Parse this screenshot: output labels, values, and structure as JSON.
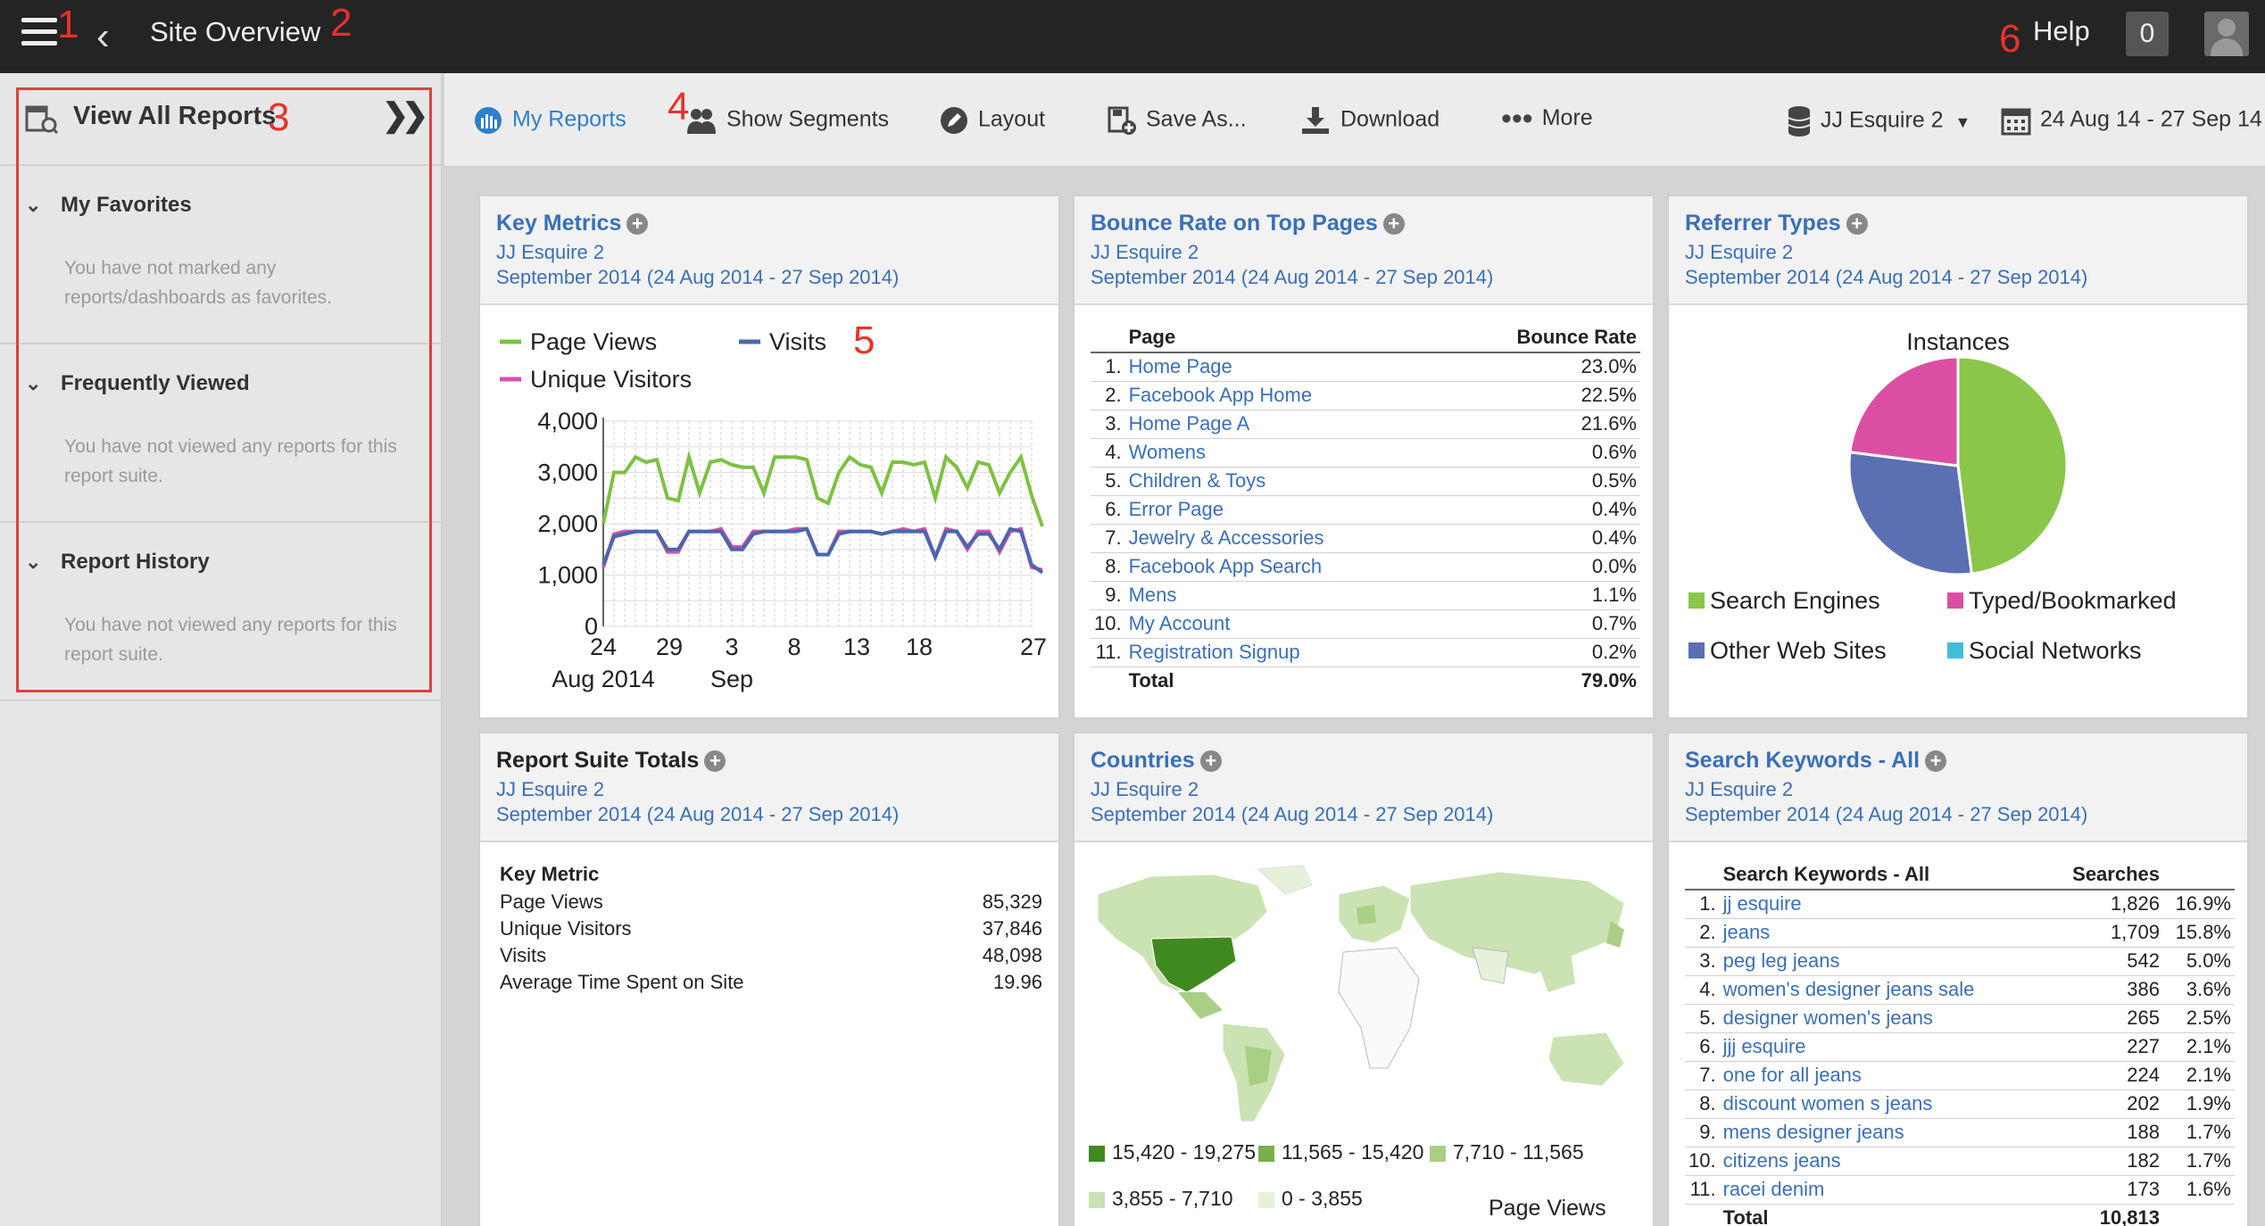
{
  "topbar": {
    "title": "Site Overview",
    "help": "Help",
    "notification_count": "0"
  },
  "annotations": [
    "1",
    "2",
    "3",
    "4",
    "5",
    "6"
  ],
  "sidebar": {
    "header": "View All Reports",
    "sections": [
      {
        "title": "My Favorites",
        "message": "You have not marked any reports/dashboards as favorites."
      },
      {
        "title": "Frequently Viewed",
        "message": "You have not viewed any reports for this report suite."
      },
      {
        "title": "Report History",
        "message": "You have not viewed any reports for this report suite."
      }
    ]
  },
  "toolbar": {
    "my_reports": "My Reports",
    "show_segments": "Show Segments",
    "layout": "Layout",
    "save_as": "Save As...",
    "download": "Download",
    "more": "More",
    "report_suite": "JJ Esquire 2",
    "date_range": "24 Aug 14 - 27 Sep 14"
  },
  "common": {
    "suite": "JJ Esquire 2",
    "period": "September 2014 (24 Aug 2014 - 27 Sep 2014)"
  },
  "cards": {
    "key_metrics": {
      "title": "Key Metrics"
    },
    "bounce": {
      "title": "Bounce Rate on Top Pages",
      "col_page": "Page",
      "col_rate": "Bounce Rate"
    },
    "referrer": {
      "title": "Referrer Types"
    },
    "totals": {
      "title": "Report Suite Totals",
      "col_metric": "Key Metric"
    },
    "countries": {
      "title": "Countries"
    },
    "keywords": {
      "title": "Search Keywords - All",
      "col_kw": "Search Keywords - All",
      "col_searches": "Searches"
    }
  },
  "bounce_rows": [
    {
      "n": "1.",
      "page": "Home Page",
      "rate": "23.0%"
    },
    {
      "n": "2.",
      "page": "Facebook App Home",
      "rate": "22.5%"
    },
    {
      "n": "3.",
      "page": "Home Page A",
      "rate": "21.6%"
    },
    {
      "n": "4.",
      "page": "Womens",
      "rate": "0.6%"
    },
    {
      "n": "5.",
      "page": "Children & Toys",
      "rate": "0.5%"
    },
    {
      "n": "6.",
      "page": "Error Page",
      "rate": "0.4%"
    },
    {
      "n": "7.",
      "page": "Jewelry & Accessories",
      "rate": "0.4%"
    },
    {
      "n": "8.",
      "page": "Facebook App Search",
      "rate": "0.0%"
    },
    {
      "n": "9.",
      "page": "Mens",
      "rate": "1.1%"
    },
    {
      "n": "10.",
      "page": "My Account",
      "rate": "0.7%"
    },
    {
      "n": "11.",
      "page": "Registration Signup",
      "rate": "0.2%"
    }
  ],
  "bounce_total": {
    "label": "Total",
    "rate": "79.0%"
  },
  "totals_rows": [
    {
      "metric": "Page Views",
      "value": "85,329"
    },
    {
      "metric": "Unique Visitors",
      "value": "37,846"
    },
    {
      "metric": "Visits",
      "value": "48,098"
    },
    {
      "metric": "Average Time Spent on Site",
      "value": "19.96"
    }
  ],
  "keyword_rows": [
    {
      "n": "1.",
      "kw": "jj esquire",
      "searches": "1,826",
      "pct": "16.9%"
    },
    {
      "n": "2.",
      "kw": "jeans",
      "searches": "1,709",
      "pct": "15.8%"
    },
    {
      "n": "3.",
      "kw": "peg leg jeans",
      "searches": "542",
      "pct": "5.0%"
    },
    {
      "n": "4.",
      "kw": "women's designer jeans sale",
      "searches": "386",
      "pct": "3.6%"
    },
    {
      "n": "5.",
      "kw": "designer women's jeans",
      "searches": "265",
      "pct": "2.5%"
    },
    {
      "n": "6.",
      "kw": "jjj esquire",
      "searches": "227",
      "pct": "2.1%"
    },
    {
      "n": "7.",
      "kw": "one for all jeans",
      "searches": "224",
      "pct": "2.1%"
    },
    {
      "n": "8.",
      "kw": "discount women s jeans",
      "searches": "202",
      "pct": "1.9%"
    },
    {
      "n": "9.",
      "kw": "mens designer jeans",
      "searches": "188",
      "pct": "1.7%"
    },
    {
      "n": "10.",
      "kw": "citizens jeans",
      "searches": "182",
      "pct": "1.7%"
    },
    {
      "n": "11.",
      "kw": "racei denim",
      "searches": "173",
      "pct": "1.6%"
    }
  ],
  "keyword_total": {
    "label": "Total",
    "searches": "10,813"
  },
  "countries_legend": {
    "ranges": [
      "15,420 - 19,275",
      "11,565 - 15,420",
      "7,710 - 11,565",
      "3,855 - 7,710",
      "0 - 3,855"
    ],
    "colors": [
      "#3f8a1e",
      "#79b04a",
      "#a9cf85",
      "#cbe2b2",
      "#e6f1da"
    ],
    "metric": "Page Views"
  },
  "chart_data": [
    {
      "type": "line",
      "series": [
        {
          "name": "Page Views",
          "color": "#7dc142",
          "values": [
            2000,
            3000,
            3000,
            3300,
            3200,
            3250,
            2500,
            2450,
            3300,
            2600,
            3200,
            3250,
            3150,
            3100,
            3100,
            2600,
            3300,
            3300,
            3300,
            3250,
            2500,
            2400,
            3000,
            3300,
            3150,
            3100,
            2600,
            3200,
            3200,
            3150,
            3200,
            2500,
            3300,
            3100,
            2700,
            3200,
            3150,
            2600,
            3000,
            3300,
            2550,
            1950
          ]
        },
        {
          "name": "Visits",
          "color": "#4a66ad",
          "values": [
            1200,
            1750,
            1800,
            1850,
            1850,
            1850,
            1500,
            1500,
            1850,
            1850,
            1850,
            1850,
            1500,
            1500,
            1800,
            1850,
            1850,
            1850,
            1850,
            1900,
            1400,
            1400,
            1800,
            1850,
            1850,
            1850,
            1800,
            1850,
            1850,
            1850,
            1850,
            1350,
            1850,
            1850,
            1550,
            1800,
            1800,
            1500,
            1900,
            1850,
            1200,
            1050
          ]
        },
        {
          "name": "Unique Visitors",
          "color": "#d94fac",
          "values": [
            1150,
            1800,
            1850,
            1850,
            1850,
            1850,
            1450,
            1450,
            1850,
            1850,
            1850,
            1900,
            1550,
            1550,
            1850,
            1850,
            1850,
            1850,
            1900,
            1900,
            1400,
            1400,
            1850,
            1850,
            1850,
            1850,
            1800,
            1850,
            1900,
            1850,
            1900,
            1350,
            1900,
            1850,
            1500,
            1850,
            1850,
            1450,
            1850,
            1900,
            1150,
            1100
          ]
        }
      ],
      "ylim": [
        0,
        4000
      ],
      "yticks": [
        "4,000",
        "3,000",
        "2,000",
        "1,000",
        "0"
      ],
      "xticks": [
        "24",
        "29",
        "3",
        "8",
        "13",
        "18",
        "27"
      ],
      "xlabels": [
        "Aug 2014",
        "Sep"
      ],
      "grid": true,
      "legend": "top-left"
    },
    {
      "type": "pie",
      "title": "Instances",
      "labels": [
        "Search Engines",
        "Other Web Sites",
        "Typed/Bookmarked",
        "Social Networks"
      ],
      "values": [
        48,
        29,
        23,
        0
      ],
      "colors": [
        "#8ac64a",
        "#5b6fb3",
        "#da4fa4",
        "#3fbfd6"
      ],
      "legend": "bottom"
    }
  ]
}
